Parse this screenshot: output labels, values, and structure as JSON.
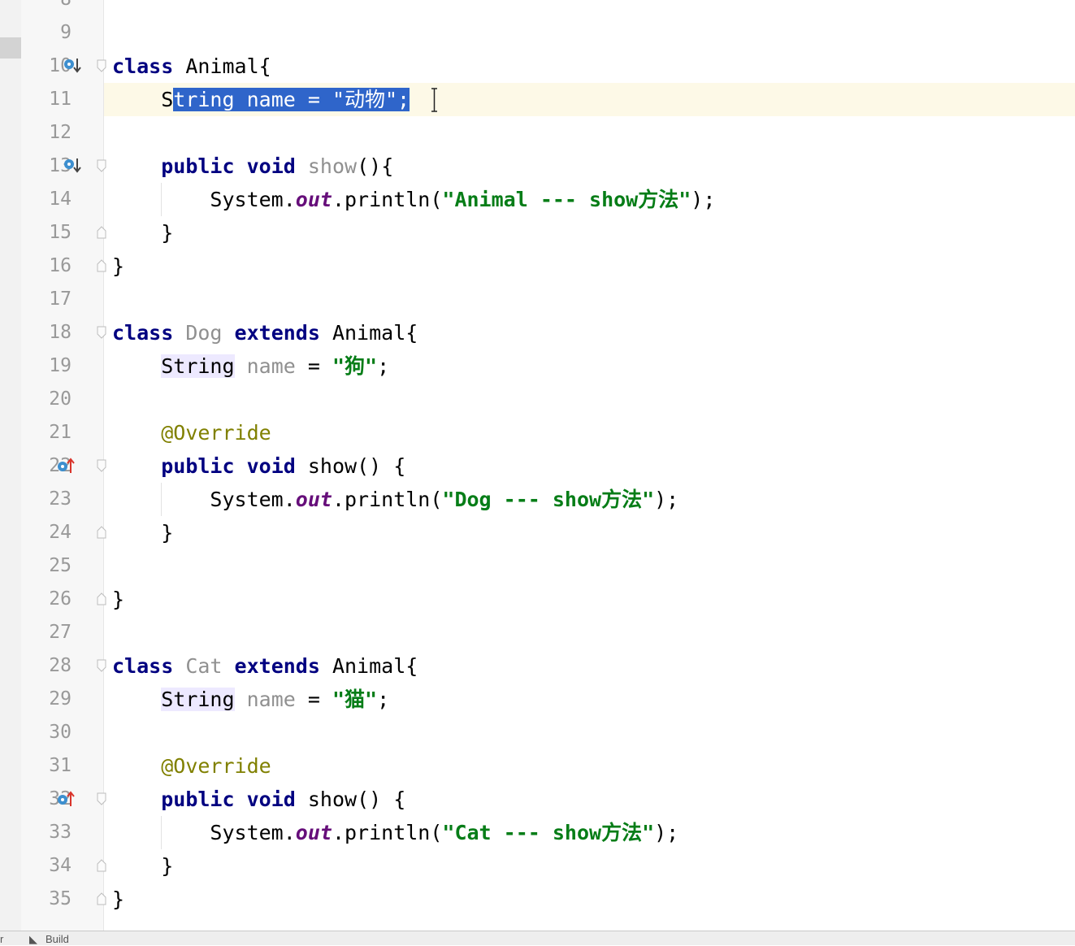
{
  "top_partial_line_number": "8",
  "lines": [
    {
      "n": "9",
      "tokens": []
    },
    {
      "n": "10",
      "marker": "override-down",
      "fold": "open",
      "tokens": [
        {
          "t": "class",
          "c": "kw"
        },
        {
          "t": " Animal{"
        }
      ]
    },
    {
      "n": "11",
      "current": true,
      "tokens": [
        {
          "t": "    "
        },
        {
          "t": "S"
        },
        {
          "t": "tring name = \"动物\";",
          "c": "sel"
        }
      ]
    },
    {
      "n": "12",
      "tokens": []
    },
    {
      "n": "13",
      "marker": "override-down",
      "fold": "open",
      "tokens": [
        {
          "t": "    "
        },
        {
          "t": "public",
          "c": "kw"
        },
        {
          "t": " "
        },
        {
          "t": "void",
          "c": "kw"
        },
        {
          "t": " "
        },
        {
          "t": "show",
          "c": "gray"
        },
        {
          "t": "(){"
        }
      ]
    },
    {
      "n": "14",
      "tokens": [
        {
          "t": "        System."
        },
        {
          "t": "out",
          "c": "static"
        },
        {
          "t": ".println("
        },
        {
          "t": "\"Animal --- show方法\"",
          "c": "str"
        },
        {
          "t": ");"
        }
      ]
    },
    {
      "n": "15",
      "fold": "end",
      "tokens": [
        {
          "t": "    }"
        }
      ]
    },
    {
      "n": "16",
      "fold": "end",
      "tokens": [
        {
          "t": "}"
        }
      ]
    },
    {
      "n": "17",
      "tokens": []
    },
    {
      "n": "18",
      "fold": "open",
      "tokens": [
        {
          "t": "class",
          "c": "kw"
        },
        {
          "t": " "
        },
        {
          "t": "Dog",
          "c": "gray"
        },
        {
          "t": " "
        },
        {
          "t": "extends",
          "c": "kw"
        },
        {
          "t": " Animal{"
        }
      ]
    },
    {
      "n": "19",
      "tokens": [
        {
          "t": "    "
        },
        {
          "t": "String",
          "c": "hl"
        },
        {
          "t": " "
        },
        {
          "t": "name",
          "c": "gray"
        },
        {
          "t": " = "
        },
        {
          "t": "\"狗\"",
          "c": "str"
        },
        {
          "t": ";"
        }
      ]
    },
    {
      "n": "20",
      "tokens": []
    },
    {
      "n": "21",
      "tokens": [
        {
          "t": "    "
        },
        {
          "t": "@Override",
          "c": "ann"
        }
      ]
    },
    {
      "n": "22",
      "marker": "override-up",
      "fold": "open",
      "tokens": [
        {
          "t": "    "
        },
        {
          "t": "public",
          "c": "kw"
        },
        {
          "t": " "
        },
        {
          "t": "void",
          "c": "kw"
        },
        {
          "t": " show() {"
        }
      ]
    },
    {
      "n": "23",
      "tokens": [
        {
          "t": "        System."
        },
        {
          "t": "out",
          "c": "static"
        },
        {
          "t": ".println("
        },
        {
          "t": "\"Dog --- show方法\"",
          "c": "str"
        },
        {
          "t": ");"
        }
      ]
    },
    {
      "n": "24",
      "fold": "end",
      "tokens": [
        {
          "t": "    }"
        }
      ]
    },
    {
      "n": "25",
      "tokens": []
    },
    {
      "n": "26",
      "fold": "end",
      "tokens": [
        {
          "t": "}"
        }
      ]
    },
    {
      "n": "27",
      "tokens": []
    },
    {
      "n": "28",
      "fold": "open",
      "tokens": [
        {
          "t": "class",
          "c": "kw"
        },
        {
          "t": " "
        },
        {
          "t": "Cat",
          "c": "gray"
        },
        {
          "t": " "
        },
        {
          "t": "extends",
          "c": "kw"
        },
        {
          "t": " Animal{"
        }
      ]
    },
    {
      "n": "29",
      "tokens": [
        {
          "t": "    "
        },
        {
          "t": "String",
          "c": "hl"
        },
        {
          "t": " "
        },
        {
          "t": "name",
          "c": "gray"
        },
        {
          "t": " = "
        },
        {
          "t": "\"猫\"",
          "c": "str"
        },
        {
          "t": ";"
        }
      ]
    },
    {
      "n": "30",
      "tokens": []
    },
    {
      "n": "31",
      "tokens": [
        {
          "t": "    "
        },
        {
          "t": "@Override",
          "c": "ann"
        }
      ]
    },
    {
      "n": "32",
      "marker": "override-up",
      "fold": "open",
      "tokens": [
        {
          "t": "    "
        },
        {
          "t": "public",
          "c": "kw"
        },
        {
          "t": " "
        },
        {
          "t": "void",
          "c": "kw"
        },
        {
          "t": " show() {"
        }
      ]
    },
    {
      "n": "33",
      "tokens": [
        {
          "t": "        System."
        },
        {
          "t": "out",
          "c": "static"
        },
        {
          "t": ".println("
        },
        {
          "t": "\"Cat --- show方法\"",
          "c": "str"
        },
        {
          "t": ");"
        }
      ]
    },
    {
      "n": "34",
      "fold": "end",
      "tokens": [
        {
          "t": "    }"
        }
      ]
    },
    {
      "n": "35",
      "fold": "end",
      "tokens": [
        {
          "t": "}"
        }
      ]
    }
  ],
  "bottom_bar": {
    "left_fragment": "r",
    "build_label": "Build"
  },
  "colors": {
    "keyword": "#000080",
    "string": "#067d17",
    "annotation": "#808000",
    "static_field": "#660e7a",
    "selection": "#2f65ca",
    "current_line": "#fdf9e7",
    "override_marker": "#3d8fcf",
    "implemented_arrow": "#d9342b"
  }
}
